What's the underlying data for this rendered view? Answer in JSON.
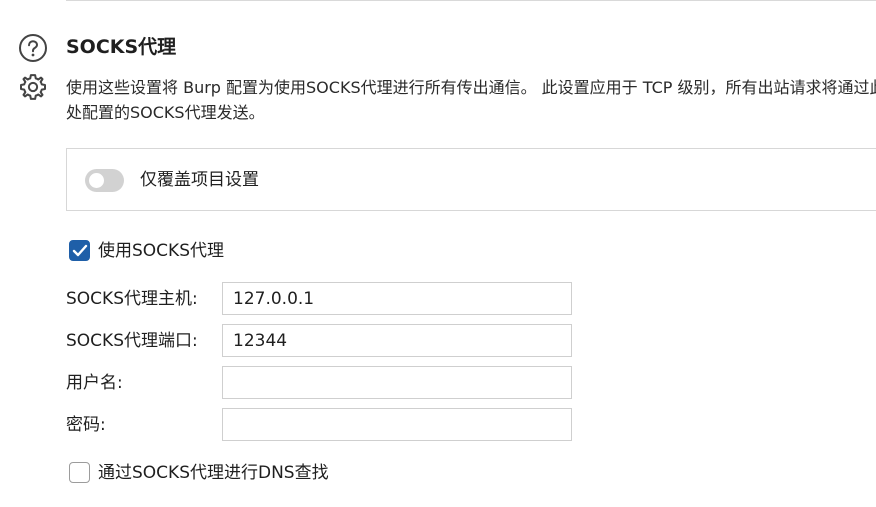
{
  "section": {
    "title": "SOCKS代理",
    "description": "使用这些设置将 Burp 配置为使用SOCKS代理进行所有传出通信。 此设置应用于 TCP 级别，所有出站请求将通过此处配置的SOCKS代理发送。"
  },
  "override": {
    "label": "仅覆盖项目设置",
    "enabled": false
  },
  "use_socks": {
    "label": "使用SOCKS代理",
    "checked": true
  },
  "fields": {
    "host_label": "SOCKS代理主机:",
    "host_value": "127.0.0.1",
    "port_label": "SOCKS代理端口:",
    "port_value": "12344",
    "username_label": "用户名:",
    "username_value": "",
    "password_label": "密码:",
    "password_value": ""
  },
  "dns": {
    "label": "通过SOCKS代理进行DNS查找",
    "checked": false
  },
  "colors": {
    "accent": "#1f5fa8",
    "toggle_off": "#d2d2d2",
    "border": "#cfcfcf"
  },
  "icons": {
    "help": "help-icon",
    "settings": "gear-icon"
  }
}
